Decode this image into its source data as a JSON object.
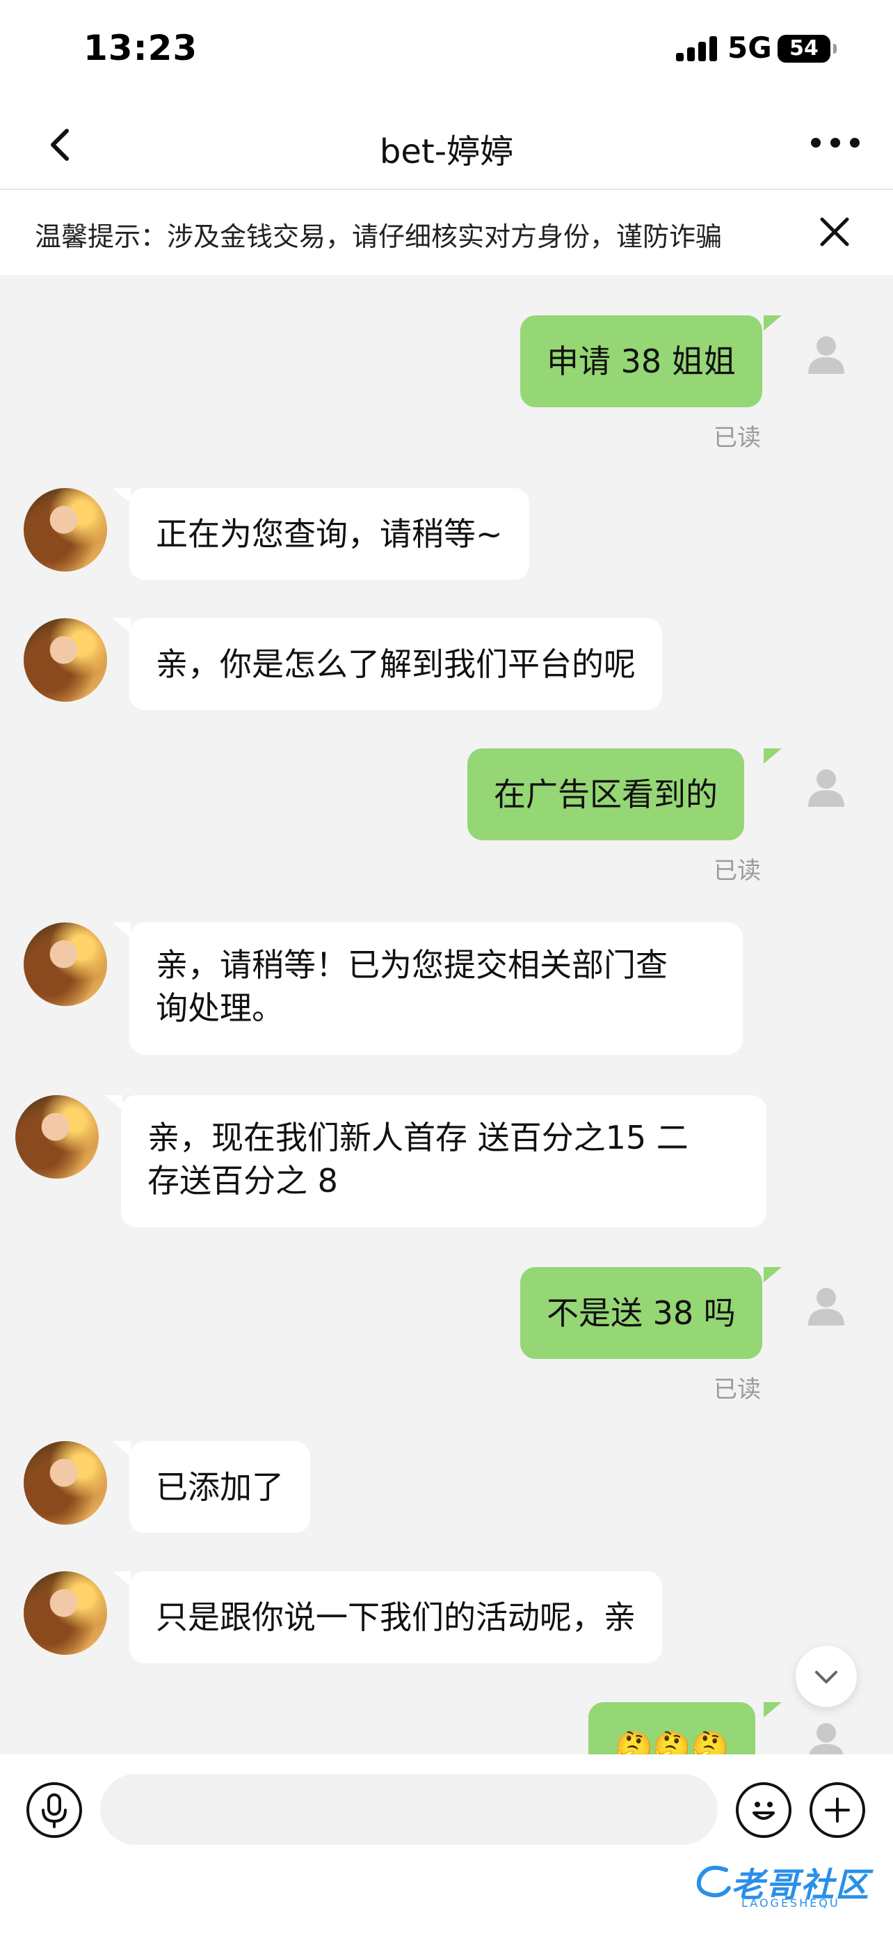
{
  "status_bar": {
    "time": "13:23",
    "network": "5G",
    "battery": "54"
  },
  "header": {
    "title": "bet-婷婷"
  },
  "warning": {
    "text": "温馨提示：涉及金钱交易，请仔细核实对方身份，谨防诈骗"
  },
  "messages": [
    {
      "side": "right",
      "text": "申请 38 姐姐",
      "status": "已读"
    },
    {
      "side": "left",
      "text": "正在为您查询，请稍等~"
    },
    {
      "side": "left",
      "text": "亲，你是怎么了解到我们平台的呢"
    },
    {
      "side": "right",
      "text": "在广告区看到的",
      "status": "已读"
    },
    {
      "side": "left",
      "lines": [
        "亲，请稍等！已为您提交相关部门查",
        "询处理。"
      ]
    },
    {
      "side": "left",
      "lines": [
        "亲，现在我们新人首存 送百分之15  二",
        "存送百分之 8"
      ]
    },
    {
      "side": "right",
      "text": "不是送 38 吗",
      "status": "已读"
    },
    {
      "side": "left",
      "text": "已添加了"
    },
    {
      "side": "left",
      "text": "只是跟你说一下我们的活动呢，亲"
    },
    {
      "side": "right",
      "text": "🤔🤔🤔"
    }
  ],
  "input": {
    "placeholder": ""
  },
  "watermark": {
    "text": "老哥社区",
    "sub": "LAOGESHEQU"
  },
  "colors": {
    "sent_bubble": "#95d675",
    "received_bubble": "#ffffff",
    "background": "#f3f3f4"
  }
}
